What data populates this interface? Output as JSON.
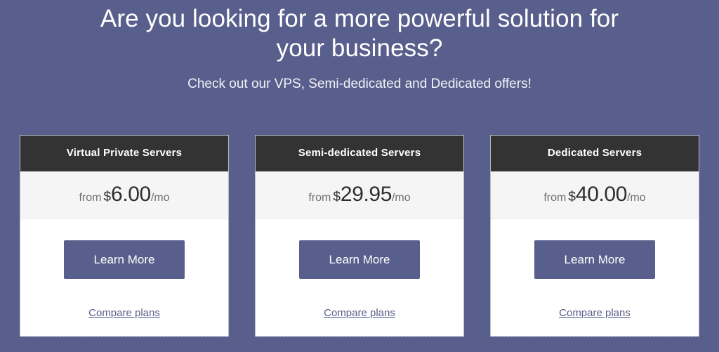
{
  "theme": {
    "page_background": "#595f8c",
    "accent": "#595f8c",
    "card_header_background": "#333333",
    "price_band_background": "#f5f5f5",
    "card_background": "#ffffff",
    "heading_color": "#ffffff",
    "muted_text": "#6f6f75",
    "price_text": "#2f2f33"
  },
  "promo": {
    "title": "Are you looking for a more powerful solution for your business?",
    "subtitle": "Check out our VPS, Semi-dedicated and Dedicated offers!"
  },
  "plans": [
    {
      "name": "Virtual Private Servers",
      "price_prefix": "from",
      "currency": "$",
      "amount": "6.00",
      "period": "/mo",
      "cta_label": "Learn More",
      "compare_label": "Compare plans"
    },
    {
      "name": "Semi-dedicated Servers",
      "price_prefix": "from",
      "currency": "$",
      "amount": "29.95",
      "period": "/mo",
      "cta_label": "Learn More",
      "compare_label": "Compare plans"
    },
    {
      "name": "Dedicated Servers",
      "price_prefix": "from",
      "currency": "$",
      "amount": "40.00",
      "period": "/mo",
      "cta_label": "Learn More",
      "compare_label": "Compare plans"
    }
  ]
}
